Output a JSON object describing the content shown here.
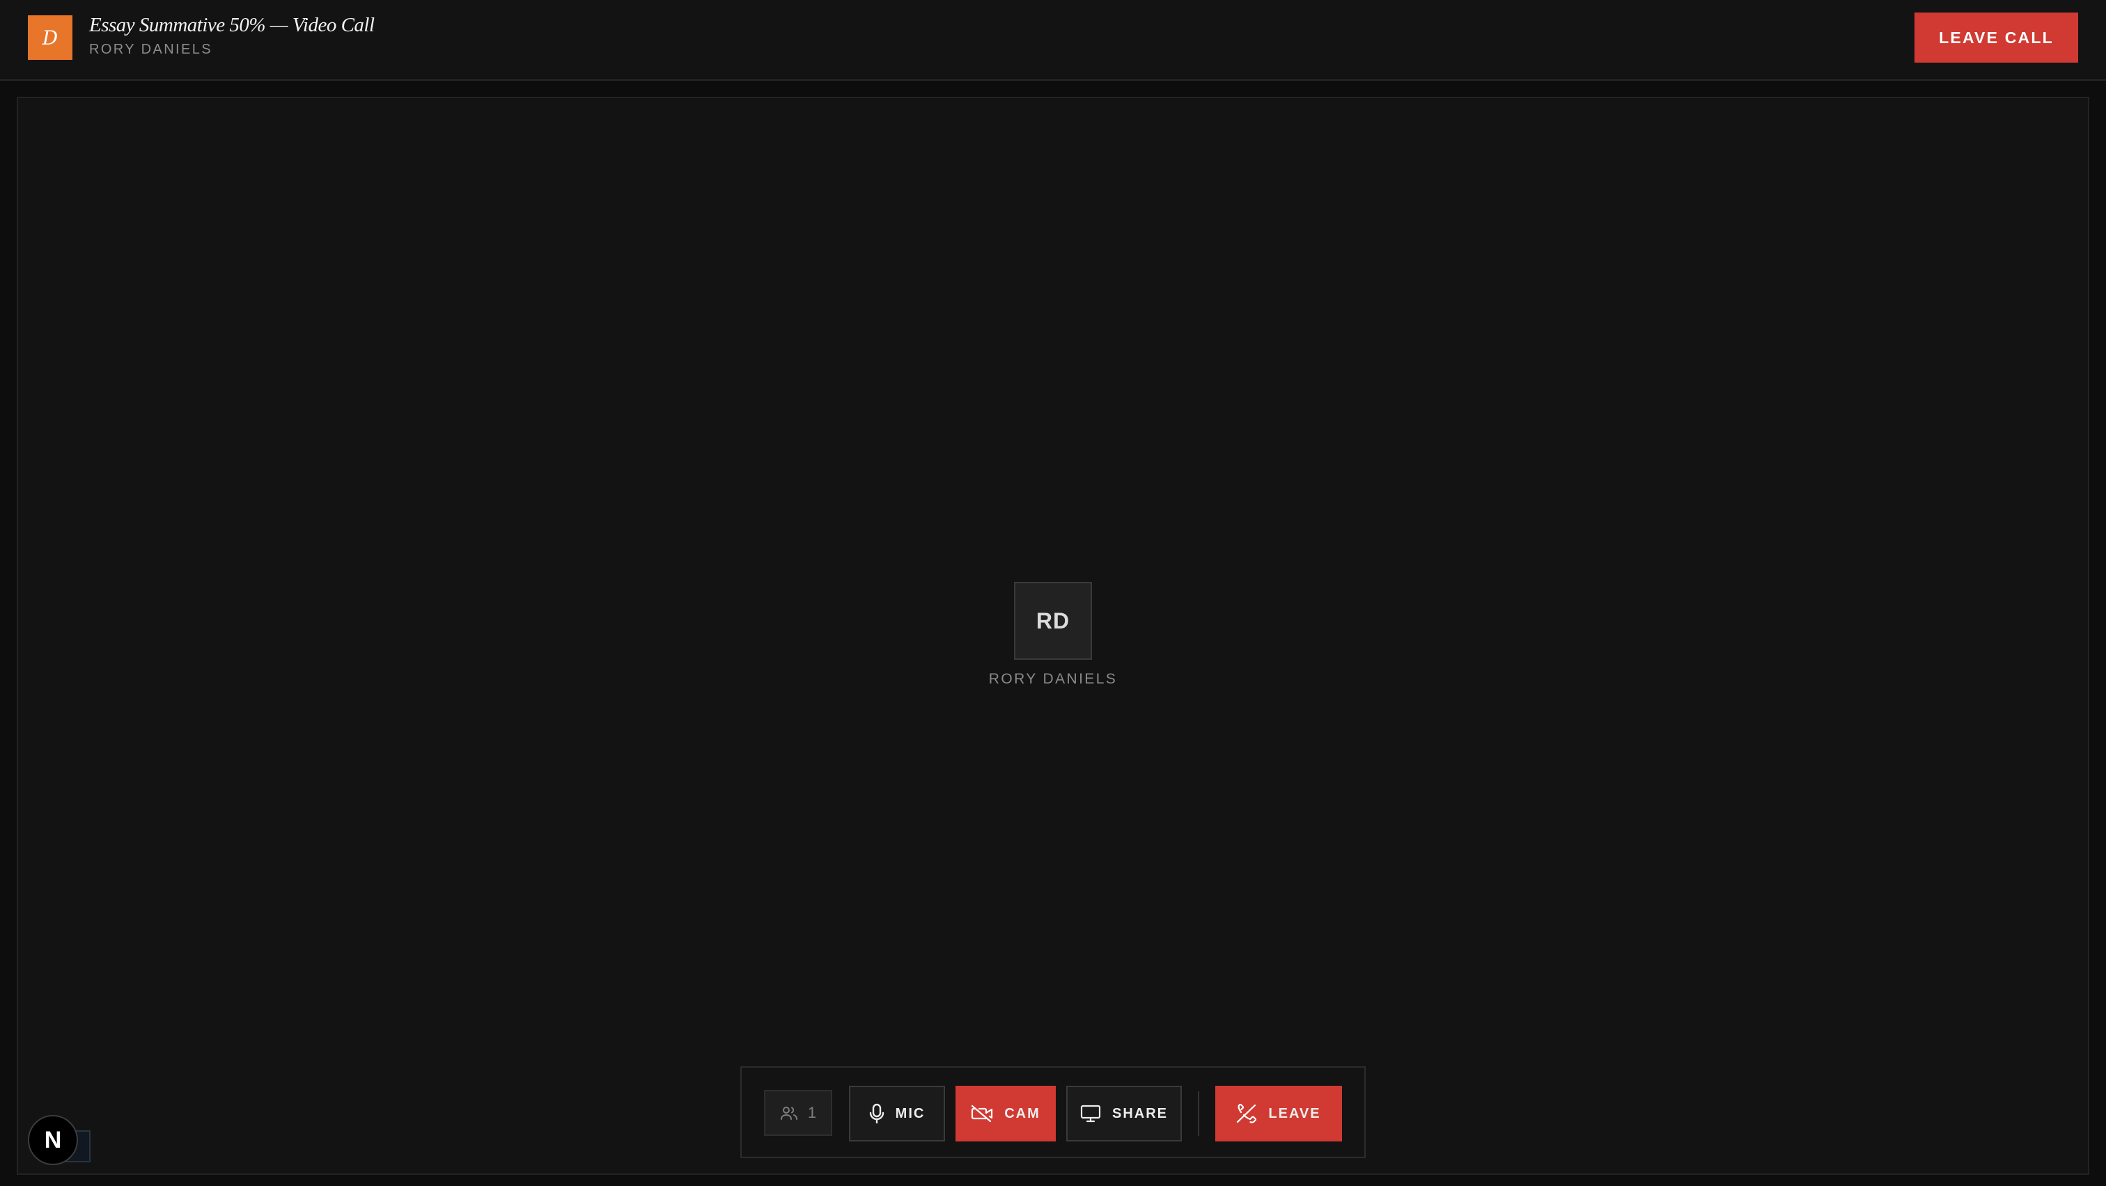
{
  "header": {
    "logo_letter": "D",
    "title": "Essay Summative 50% — Video Call",
    "subtitle": "RORY DANIELS",
    "leave_call_label": "LEAVE CALL"
  },
  "stage": {
    "avatar_initials": "RD",
    "participant_name": "RORY DANIELS"
  },
  "controls": {
    "participant_count": "1",
    "mic_label": "MIC",
    "cam_label": "CAM",
    "share_label": "SHARE",
    "leave_label": "LEAVE"
  },
  "dev_badge": {
    "letter": "N"
  },
  "colors": {
    "accent_orange": "#e7762b",
    "danger_red": "#d03a32",
    "background": "#131313"
  }
}
